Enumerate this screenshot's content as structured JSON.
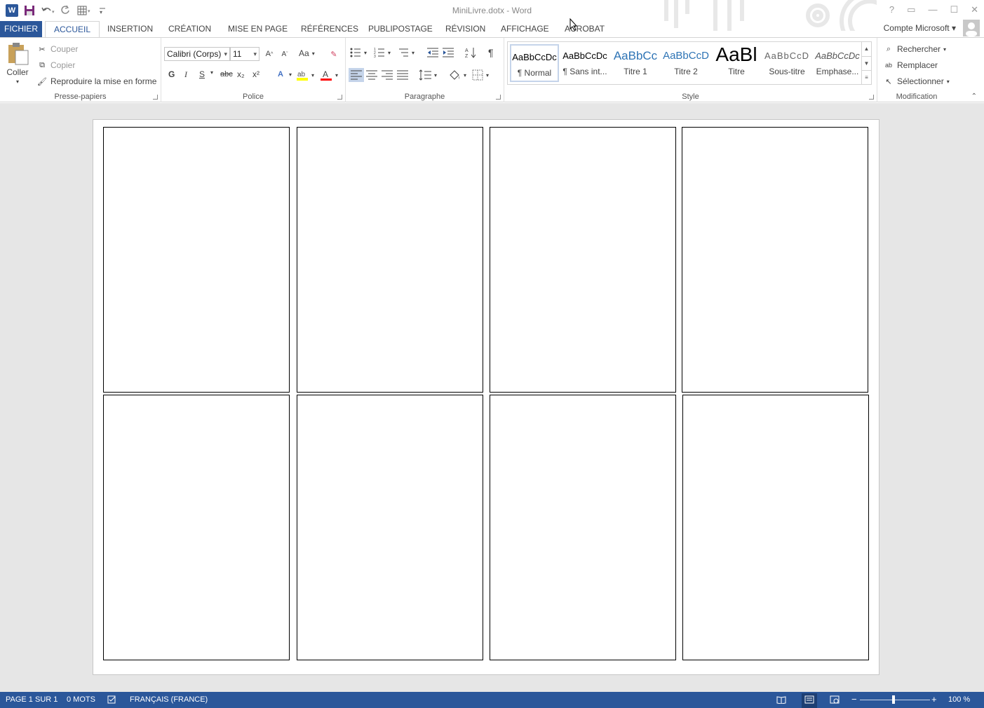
{
  "window": {
    "title": "MiniLivre.dotx - Word",
    "help": "?",
    "account": "Compte Microsoft"
  },
  "tabs": [
    {
      "label": "FICHIER"
    },
    {
      "label": "ACCUEIL"
    },
    {
      "label": "INSERTION"
    },
    {
      "label": "CRÉATION"
    },
    {
      "label": "MISE EN PAGE"
    },
    {
      "label": "RÉFÉRENCES"
    },
    {
      "label": "PUBLIPOSTAGE"
    },
    {
      "label": "RÉVISION"
    },
    {
      "label": "AFFICHAGE"
    },
    {
      "label": "ACROBAT"
    }
  ],
  "clipboard": {
    "paste": "Coller",
    "cut": "Couper",
    "copy": "Copier",
    "format_painter": "Reproduire la mise en forme",
    "label": "Presse-papiers"
  },
  "font": {
    "name": "Calibri (Corps)",
    "size": "11",
    "bold": "G",
    "italic": "I",
    "underline": "S",
    "strike": "abc",
    "subscript": "x₂",
    "superscript": "x²",
    "case": "Aa",
    "label": "Police"
  },
  "paragraph": {
    "label": "Paragraphe",
    "pilcrow": "¶"
  },
  "styles": {
    "label": "Style",
    "items": [
      {
        "preview": "AaBbCcDc",
        "name": "¶ Normal"
      },
      {
        "preview": "AaBbCcDc",
        "name": "¶ Sans int..."
      },
      {
        "preview": "AaBbCc",
        "name": "Titre 1"
      },
      {
        "preview": "AaBbCcD",
        "name": "Titre 2"
      },
      {
        "preview": "AaBl",
        "name": "Titre"
      },
      {
        "preview": "AaBbCcD",
        "name": "Sous-titre"
      },
      {
        "preview": "AaBbCcDc",
        "name": "Emphase..."
      }
    ]
  },
  "editing": {
    "find": "Rechercher",
    "replace": "Remplacer",
    "select": "Sélectionner",
    "label": "Modification"
  },
  "status": {
    "page": "PAGE 1 SUR 1",
    "words": "0 MOTS",
    "language": "FRANÇAIS (FRANCE)",
    "zoom": "100 %",
    "zoom_minus": "−",
    "zoom_plus": "+"
  },
  "colors": {
    "accent": "#2b579a",
    "highlight": "#ffff00",
    "font_color": "#ff0000"
  }
}
